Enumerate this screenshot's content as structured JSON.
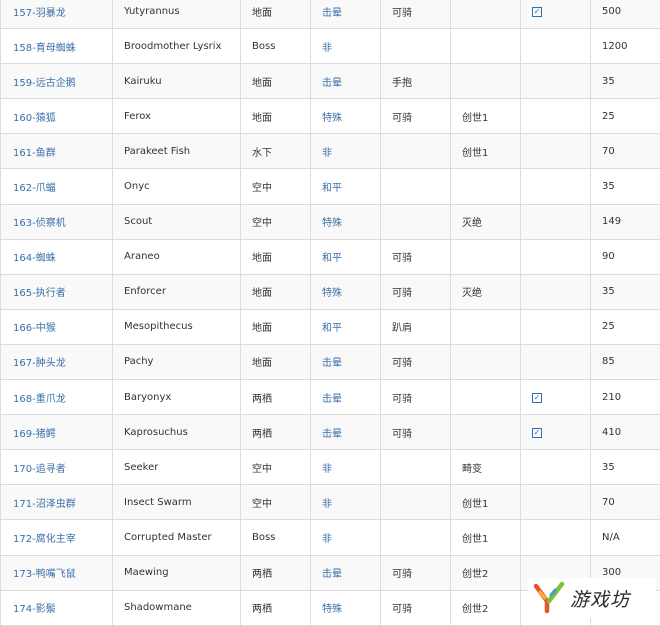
{
  "table": {
    "rows": [
      {
        "name": "157-羽暴龙",
        "en": "Yutyrannus",
        "type": "地面",
        "temper": "击晕",
        "ride": "可骑",
        "dlc": "",
        "cb": true,
        "val": "500"
      },
      {
        "name": "158-育母蜘蛛",
        "en": "Broodmother Lysrix",
        "type": "Boss",
        "temper": "非",
        "ride": "",
        "dlc": "",
        "cb": false,
        "val": "1200"
      },
      {
        "name": "159-远古企鹅",
        "en": "Kairuku",
        "type": "地面",
        "temper": "击晕",
        "ride": "手抱",
        "dlc": "",
        "cb": false,
        "val": "35"
      },
      {
        "name": "160-猿狐",
        "en": "Ferox",
        "type": "地面",
        "temper": "特殊",
        "ride": "可骑",
        "dlc": "创世1",
        "cb": false,
        "val": "25"
      },
      {
        "name": "161-鱼群",
        "en": "Parakeet Fish",
        "type": "水下",
        "temper": "非",
        "ride": "",
        "dlc": "创世1",
        "cb": false,
        "val": "70"
      },
      {
        "name": "162-爪蝠",
        "en": "Onyc",
        "type": "空中",
        "temper": "和平",
        "ride": "",
        "dlc": "",
        "cb": false,
        "val": "35"
      },
      {
        "name": "163-侦察机",
        "en": "Scout",
        "type": "空中",
        "temper": "特殊",
        "ride": "",
        "dlc": "灭绝",
        "cb": false,
        "val": "149"
      },
      {
        "name": "164-蜘蛛",
        "en": "Araneo",
        "type": "地面",
        "temper": "和平",
        "ride": "可骑",
        "dlc": "",
        "cb": false,
        "val": "90"
      },
      {
        "name": "165-执行者",
        "en": "Enforcer",
        "type": "地面",
        "temper": "特殊",
        "ride": "可骑",
        "dlc": "灭绝",
        "cb": false,
        "val": "35"
      },
      {
        "name": "166-中猴",
        "en": "Mesopithecus",
        "type": "地面",
        "temper": "和平",
        "ride": "趴肩",
        "dlc": "",
        "cb": false,
        "val": "25"
      },
      {
        "name": "167-肿头龙",
        "en": "Pachy",
        "type": "地面",
        "temper": "击晕",
        "ride": "可骑",
        "dlc": "",
        "cb": false,
        "val": "85"
      },
      {
        "name": "168-重爪龙",
        "en": "Baryonyx",
        "type": "两栖",
        "temper": "击晕",
        "ride": "可骑",
        "dlc": "",
        "cb": true,
        "val": "210"
      },
      {
        "name": "169-猪鳄",
        "en": "Kaprosuchus",
        "type": "两栖",
        "temper": "击晕",
        "ride": "可骑",
        "dlc": "",
        "cb": true,
        "val": "410"
      },
      {
        "name": "170-追寻者",
        "en": "Seeker",
        "type": "空中",
        "temper": "非",
        "ride": "",
        "dlc": "畸变",
        "cb": false,
        "val": "35"
      },
      {
        "name": "171-沼泽虫群",
        "en": "Insect Swarm",
        "type": "空中",
        "temper": "非",
        "ride": "",
        "dlc": "创世1",
        "cb": false,
        "val": "70"
      },
      {
        "name": "172-腐化主宰",
        "en": "Corrupted Master",
        "type": "Boss",
        "temper": "非",
        "ride": "",
        "dlc": "创世1",
        "cb": false,
        "val": "N/A"
      },
      {
        "name": "173-鸭嘴飞鼠",
        "en": "Maewing",
        "type": "两栖",
        "temper": "击晕",
        "ride": "可骑",
        "dlc": "创世2",
        "cb": false,
        "val": "300"
      },
      {
        "name": "174-影鬃",
        "en": "Shadowmane",
        "type": "两栖",
        "temper": "特殊",
        "ride": "可骑",
        "dlc": "创世2",
        "cb": false,
        "val": ""
      }
    ]
  },
  "checkbox_mark": "☑",
  "watermark": {
    "text": "游戏坊",
    "icon": "y-logo-icon"
  },
  "colors": {
    "link": "#3a6fa8",
    "border": "#dcdcdc",
    "stripe": "#f9f9f9",
    "check": "#2e6fb5"
  }
}
